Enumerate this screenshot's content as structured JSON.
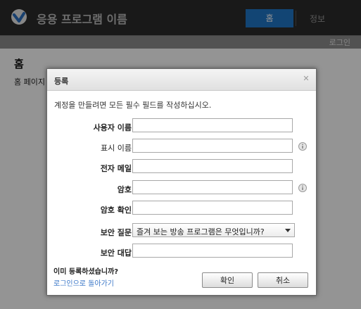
{
  "app": {
    "title": "응용 프로그램 이름",
    "nav": {
      "home": "홈",
      "about": "정보"
    },
    "login_link": "로그인"
  },
  "page": {
    "heading": "홈",
    "body": "홈 페이지"
  },
  "dialog": {
    "title": "등록",
    "instruction": "계정을 만들려면 모든 필수 필드를 작성하십시오.",
    "fields": [
      {
        "label": "사용자 이름",
        "value": ""
      },
      {
        "label": "표시 이름",
        "value": ""
      },
      {
        "label": "전자 메일",
        "value": ""
      },
      {
        "label": "암호",
        "value": ""
      },
      {
        "label": "암호 확인",
        "value": ""
      },
      {
        "label": "보안 질문",
        "value": "즐겨 보는 방송 프로그램은 무엇입니까?"
      },
      {
        "label": "보안 대답",
        "value": ""
      }
    ],
    "already_registered": "이미 등록하셨습니까?",
    "back_to_login": "로그인으로 돌아가기",
    "ok_button": "확인",
    "cancel_button": "취소"
  },
  "colors": {
    "header_bg": "#2b2b2b",
    "accent": "#1f78c8",
    "link": "#3c78c8"
  },
  "icons": {
    "logo": "app-logo-icon",
    "close": "close-icon",
    "info": "info-icon",
    "dropdown": "dropdown-arrow-icon"
  }
}
